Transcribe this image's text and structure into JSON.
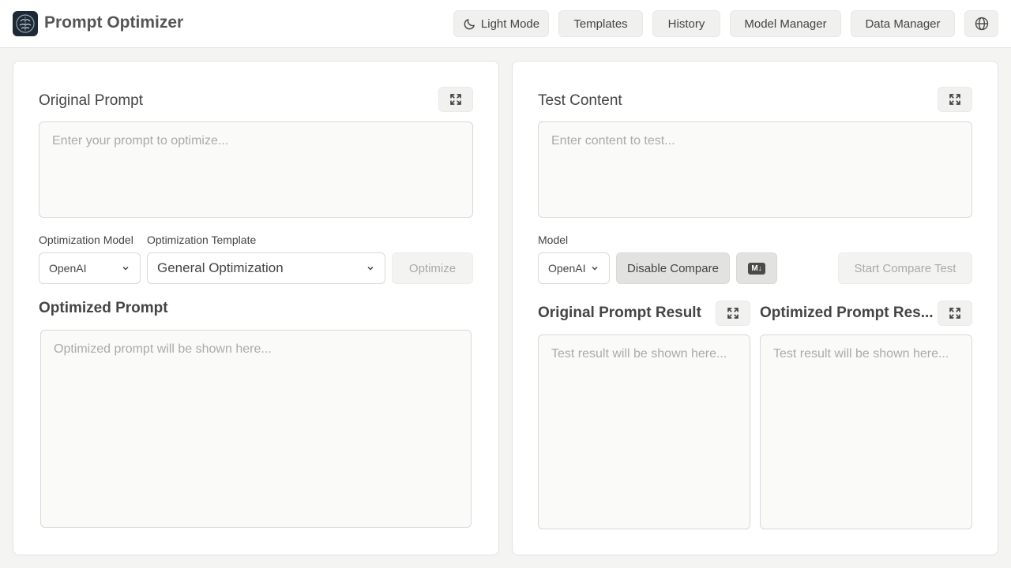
{
  "header": {
    "app_title": "Prompt Optimizer",
    "theme_label": "Light Mode",
    "templates_label": "Templates",
    "history_label": "History",
    "model_manager_label": "Model Manager",
    "data_manager_label": "Data Manager"
  },
  "left_panel": {
    "original_prompt_title": "Original Prompt",
    "original_prompt_placeholder": "Enter your prompt to optimize...",
    "optimization_model_label": "Optimization Model",
    "optimization_model_value": "OpenAI",
    "optimization_template_label": "Optimization Template",
    "optimization_template_value": "General Optimization",
    "optimize_button": "Optimize",
    "optimized_prompt_title": "Optimized Prompt",
    "optimized_prompt_placeholder": "Optimized prompt will be shown here..."
  },
  "right_panel": {
    "test_content_title": "Test Content",
    "test_content_placeholder": "Enter content to test...",
    "model_label": "Model",
    "model_value": "OpenAI",
    "disable_compare_button": "Disable Compare",
    "markdown_toggle": "M↓",
    "start_compare_button": "Start Compare Test",
    "original_result_title": "Original Prompt Result",
    "optimized_result_title": "Optimized Prompt Res...",
    "original_result_placeholder": "Test result will be shown here...",
    "optimized_result_placeholder": "Test result will be shown here..."
  },
  "colors": {
    "background": "#f4f4f3",
    "panel": "#ffffff",
    "logo_bg": "#1d2a36"
  },
  "icons": {
    "theme": "moon-icon",
    "language": "globe-icon",
    "expand": "expand-icon",
    "dropdown": "chevron-down-icon",
    "logo": "brain-logo-icon"
  }
}
